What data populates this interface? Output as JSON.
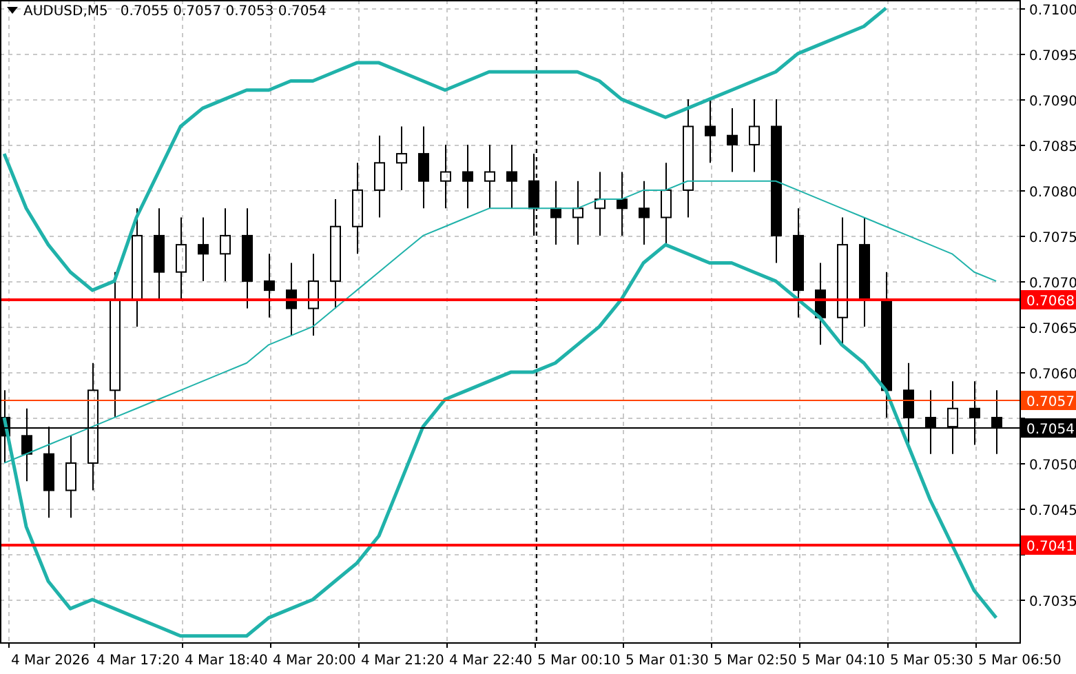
{
  "header": {
    "symbol": "AUDUSD,M5",
    "quotes": [
      "0.7055",
      "0.7057",
      "0.7053",
      "0.7054"
    ]
  },
  "chart_data": {
    "type": "candlestick",
    "grid": true,
    "ylim": [
      0.70303,
      0.71009
    ],
    "categories": [
      null,
      null,
      "4 Mar 2026",
      null,
      null,
      null,
      "4 Mar 17:20",
      null,
      null,
      null,
      "4 Mar 18:40",
      null,
      null,
      null,
      "4 Mar 20:00",
      null,
      null,
      null,
      "4 Mar 21:20",
      null,
      null,
      null,
      "4 Mar 22:40",
      null,
      null,
      null,
      "5 Mar 00:10",
      null,
      null,
      null,
      "5 Mar 01:30",
      null,
      null,
      null,
      "5 Mar 02:50",
      null,
      null,
      null,
      "5 Mar 04:10",
      null,
      null,
      null,
      "5 Mar 05:30",
      null,
      null,
      null,
      "5 Mar 06:50"
    ],
    "yticks": [
      {
        "value": 0.71,
        "label": "0.7100"
      },
      {
        "value": 0.7095,
        "label": "0.7095"
      },
      {
        "value": 0.709,
        "label": "0.7090"
      },
      {
        "value": 0.7085,
        "label": "0.7085"
      },
      {
        "value": 0.708,
        "label": "0.7080"
      },
      {
        "value": 0.7075,
        "label": "0.7075"
      },
      {
        "value": 0.707,
        "label": "0.7070"
      },
      {
        "value": 0.7065,
        "label": "0.7065"
      },
      {
        "value": 0.706,
        "label": "0.7060"
      },
      {
        "value": 0.705,
        "label": "0.7050"
      },
      {
        "value": 0.7045,
        "label": "0.7045"
      },
      {
        "value": 0.7035,
        "label": "0.7035"
      }
    ],
    "ohlc": [
      [
        0.7055,
        0.7058,
        0.705,
        0.7053
      ],
      [
        0.7053,
        0.7056,
        0.7048,
        0.7051
      ],
      [
        0.7051,
        0.7054,
        0.7044,
        0.7047
      ],
      [
        0.7047,
        0.7053,
        0.7044,
        0.705
      ],
      [
        0.705,
        0.7061,
        0.7047,
        0.7058
      ],
      [
        0.7058,
        0.7071,
        0.7055,
        0.7068
      ],
      [
        0.7068,
        0.7078,
        0.7065,
        0.7075
      ],
      [
        0.7075,
        0.7078,
        0.7068,
        0.7071
      ],
      [
        0.7071,
        0.7077,
        0.7068,
        0.7074
      ],
      [
        0.7074,
        0.7077,
        0.707,
        0.7073
      ],
      [
        0.7073,
        0.7078,
        0.707,
        0.7075
      ],
      [
        0.7075,
        0.7078,
        0.7067,
        0.707
      ],
      [
        0.707,
        0.7073,
        0.7066,
        0.7069
      ],
      [
        0.7069,
        0.7072,
        0.7064,
        0.7067
      ],
      [
        0.7067,
        0.7073,
        0.7064,
        0.707
      ],
      [
        0.707,
        0.7079,
        0.7067,
        0.7076
      ],
      [
        0.7076,
        0.7083,
        0.7073,
        0.708
      ],
      [
        0.708,
        0.7086,
        0.7077,
        0.7083
      ],
      [
        0.7083,
        0.7087,
        0.708,
        0.7084
      ],
      [
        0.7084,
        0.7087,
        0.7078,
        0.7081
      ],
      [
        0.7081,
        0.7085,
        0.7078,
        0.7082
      ],
      [
        0.7082,
        0.7085,
        0.7078,
        0.7081
      ],
      [
        0.7081,
        0.7085,
        0.7078,
        0.7082
      ],
      [
        0.7082,
        0.7085,
        0.7078,
        0.7081
      ],
      [
        0.7081,
        0.7084,
        0.7075,
        0.7078
      ],
      [
        0.7078,
        0.7081,
        0.7074,
        0.7077
      ],
      [
        0.7077,
        0.7081,
        0.7074,
        0.7078
      ],
      [
        0.7078,
        0.7082,
        0.7075,
        0.7079
      ],
      [
        0.7079,
        0.7082,
        0.7075,
        0.7078
      ],
      [
        0.7078,
        0.7081,
        0.7074,
        0.7077
      ],
      [
        0.7077,
        0.7083,
        0.7074,
        0.708
      ],
      [
        0.708,
        0.709,
        0.7077,
        0.7087
      ],
      [
        0.7087,
        0.709,
        0.7083,
        0.7086
      ],
      [
        0.7086,
        0.7089,
        0.7082,
        0.7085
      ],
      [
        0.7085,
        0.709,
        0.7082,
        0.7087
      ],
      [
        0.7087,
        0.709,
        0.7072,
        0.7075
      ],
      [
        0.7075,
        0.7078,
        0.7066,
        0.7069
      ],
      [
        0.7069,
        0.7072,
        0.7063,
        0.7066
      ],
      [
        0.7066,
        0.7077,
        0.7063,
        0.7074
      ],
      [
        0.7074,
        0.7077,
        0.7065,
        0.7068
      ],
      [
        0.7068,
        0.7071,
        0.7055,
        0.7058
      ],
      [
        0.7058,
        0.7061,
        0.7052,
        0.7055
      ],
      [
        0.7055,
        0.7058,
        0.7051,
        0.7054
      ],
      [
        0.7054,
        0.7059,
        0.7051,
        0.7056
      ],
      [
        0.7056,
        0.7059,
        0.7052,
        0.7055
      ],
      [
        0.7055,
        0.7058,
        0.7051,
        0.7054
      ],
      null
    ],
    "series": [
      {
        "type": "line",
        "color": "#20b2aa",
        "values": [
          0.7084,
          0.7078,
          0.7074,
          0.7071,
          0.7069,
          0.707,
          0.7077,
          0.7082,
          0.7087,
          0.7089,
          0.709,
          0.7091,
          0.7091,
          0.7092,
          0.7092,
          0.7093,
          0.7094,
          0.7094,
          0.7093,
          0.7092,
          0.7091,
          0.7092,
          0.7093,
          0.7093,
          0.7093,
          0.7093,
          0.7093,
          0.7092,
          0.709,
          0.7089,
          0.7088,
          0.7089,
          0.709,
          0.7091,
          0.7092,
          0.7093,
          0.7095,
          0.7096,
          0.7097,
          0.7098,
          0.71,
          null,
          null,
          null,
          null,
          null,
          null
        ]
      },
      {
        "type": "line",
        "color": "#20b2aa",
        "values": [
          0.705,
          0.7051,
          0.7052,
          0.7053,
          0.7054,
          0.7055,
          0.7056,
          0.7057,
          0.7058,
          0.7059,
          0.706,
          0.7061,
          0.7063,
          0.7064,
          0.7065,
          0.7067,
          0.7069,
          0.7071,
          0.7073,
          0.7075,
          0.7076,
          0.7077,
          0.7078,
          0.7078,
          0.7078,
          0.7078,
          0.7078,
          0.7079,
          0.7079,
          0.708,
          0.708,
          0.7081,
          0.7081,
          0.7081,
          0.7081,
          0.7081,
          0.708,
          0.7079,
          0.7078,
          0.7077,
          0.7076,
          0.7075,
          0.7074,
          0.7073,
          0.7071,
          0.707,
          null
        ]
      },
      {
        "type": "line",
        "color": "#20b2aa",
        "values": [
          0.7055,
          0.7043,
          0.7037,
          0.7034,
          0.7035,
          0.7034,
          0.7033,
          0.7032,
          0.7031,
          0.7031,
          0.7031,
          0.7031,
          0.7033,
          0.7034,
          0.7035,
          0.7037,
          0.7039,
          0.7042,
          0.7048,
          0.7054,
          0.7057,
          0.7058,
          0.7059,
          0.706,
          0.706,
          0.7061,
          0.7063,
          0.7065,
          0.7068,
          0.7072,
          0.7074,
          0.7073,
          0.7072,
          0.7072,
          0.7071,
          0.707,
          0.7068,
          0.7066,
          0.7063,
          0.7061,
          0.7058,
          0.7052,
          0.7046,
          0.7041,
          0.7036,
          0.7033,
          null
        ]
      }
    ],
    "ref_lines": [
      {
        "axis": "y",
        "value": 0.7068,
        "label": "0.7068",
        "color": "#ff0000"
      },
      {
        "axis": "y",
        "value": 0.7057,
        "label": "0.7057",
        "color": "#ff4500"
      },
      {
        "axis": "y",
        "value": 0.7054,
        "label": "0.7054",
        "color": "#000000"
      },
      {
        "axis": "y",
        "value": 0.7041,
        "label": "0.7041",
        "color": "#ff0000"
      }
    ]
  }
}
